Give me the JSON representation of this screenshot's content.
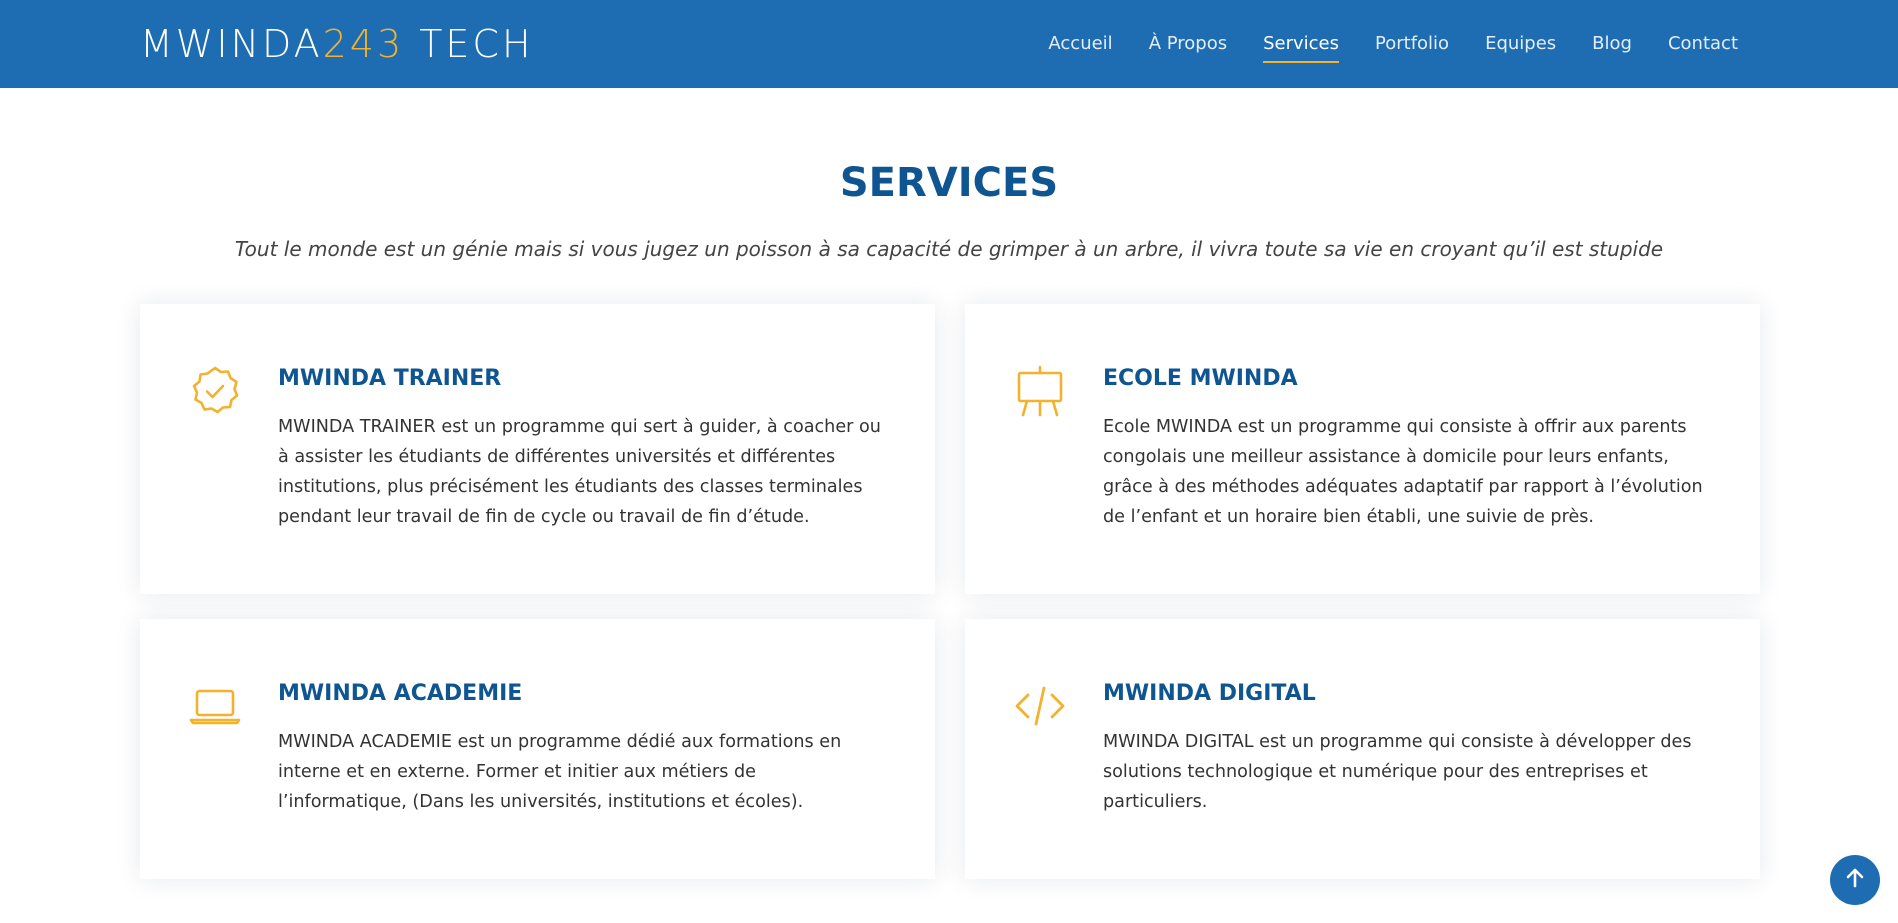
{
  "header": {
    "logo": {
      "part1": "MWINDA",
      "part2": "243",
      "part3": " TECH"
    },
    "nav": [
      {
        "label": "Accueil",
        "active": false
      },
      {
        "label": "À Propos",
        "active": false
      },
      {
        "label": "Services",
        "active": true
      },
      {
        "label": "Portfolio",
        "active": false
      },
      {
        "label": "Equipes",
        "active": false
      },
      {
        "label": "Blog",
        "active": false
      },
      {
        "label": "Contact",
        "active": false
      }
    ]
  },
  "section": {
    "title": "SERVICES",
    "subtitle": "Tout le monde est un génie mais si vous jugez un poisson à sa capacité de grimper à un arbre, il vivra toute sa vie en croyant qu’il est stupide"
  },
  "services": [
    {
      "icon": "badge-check-icon",
      "title": "MWINDA TRAINER",
      "text": "MWINDA TRAINER est un programme qui sert à guider, à coacher ou à assister les étudiants de différentes universités et différentes institutions, plus précisément les étudiants des classes terminales pendant leur travail de fin de cycle ou travail de fin d’étude."
    },
    {
      "icon": "easel-icon",
      "title": "ECOLE MWINDA",
      "text": "Ecole MWINDA est un programme qui consiste à offrir aux parents congolais une meilleur assistance à domicile pour leurs enfants, grâce à des méthodes adéquates adaptatif par rapport à l’évolution de l’enfant et un horaire bien établi, une suivie de près."
    },
    {
      "icon": "laptop-icon",
      "title": "MWINDA ACADEMIE",
      "text": "MWINDA ACADEMIE est un programme dédié aux formations en interne et en externe. Former et initier aux métiers de l’informatique, (Dans les universités, institutions et écoles)."
    },
    {
      "icon": "code-slash-icon",
      "title": "MWINDA DIGITAL",
      "text": "MWINDA DIGITAL est un programme qui consiste à développer des solutions technologique et numérique pour des entreprises et particuliers."
    }
  ],
  "colors": {
    "header_bg": "#1e6db3",
    "accent": "#f3b12c",
    "title": "#0f5592"
  }
}
